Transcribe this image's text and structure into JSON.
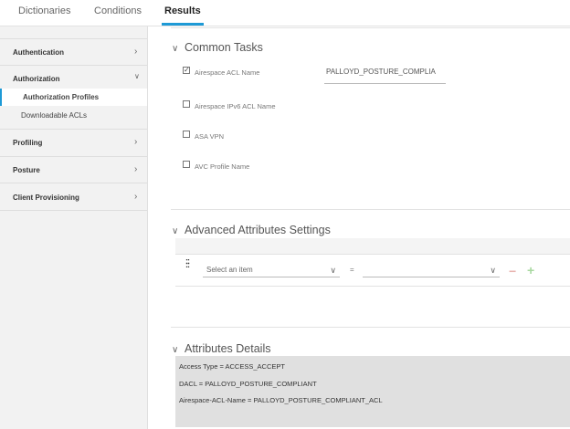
{
  "tabs": [
    {
      "label": "Dictionaries"
    },
    {
      "label": "Conditions"
    },
    {
      "label": "Results",
      "active": true
    }
  ],
  "sidebar": {
    "items": [
      {
        "label": "Authentication",
        "icon": "chevron-right-icon"
      },
      {
        "label": "Authorization",
        "icon": "chevron-down-icon",
        "children": [
          {
            "label": "Authorization Profiles",
            "selected": true
          },
          {
            "label": "Downloadable ACLs"
          }
        ]
      },
      {
        "label": "Profiling",
        "icon": "chevron-right-icon"
      },
      {
        "label": "Posture",
        "icon": "chevron-right-icon"
      },
      {
        "label": "Client Provisioning",
        "icon": "chevron-right-icon"
      }
    ]
  },
  "common_tasks": {
    "title": "Common Tasks",
    "items": [
      {
        "label": "Airespace ACL Name",
        "checked": true,
        "value": "PALLOYD_POSTURE_COMPLIA"
      },
      {
        "label": "Airespace IPv6 ACL Name",
        "checked": false
      },
      {
        "label": "ASA VPN",
        "checked": false
      },
      {
        "label": "AVC Profile Name",
        "checked": false
      }
    ]
  },
  "advanced": {
    "title": "Advanced Attributes Settings",
    "attribute_placeholder": "Select an item",
    "operator": "=",
    "value": ""
  },
  "details": {
    "title": "Attributes Details",
    "lines": [
      "Access Type = ACCESS_ACCEPT",
      "DACL = PALLOYD_POSTURE_COMPLIANT",
      "Airespace-ACL-Name = PALLOYD_POSTURE_COMPLIANT_ACL"
    ]
  },
  "colors": {
    "accent": "#1e9ad6",
    "minus": "#e8b4b0",
    "plus": "#a8d8a0"
  }
}
